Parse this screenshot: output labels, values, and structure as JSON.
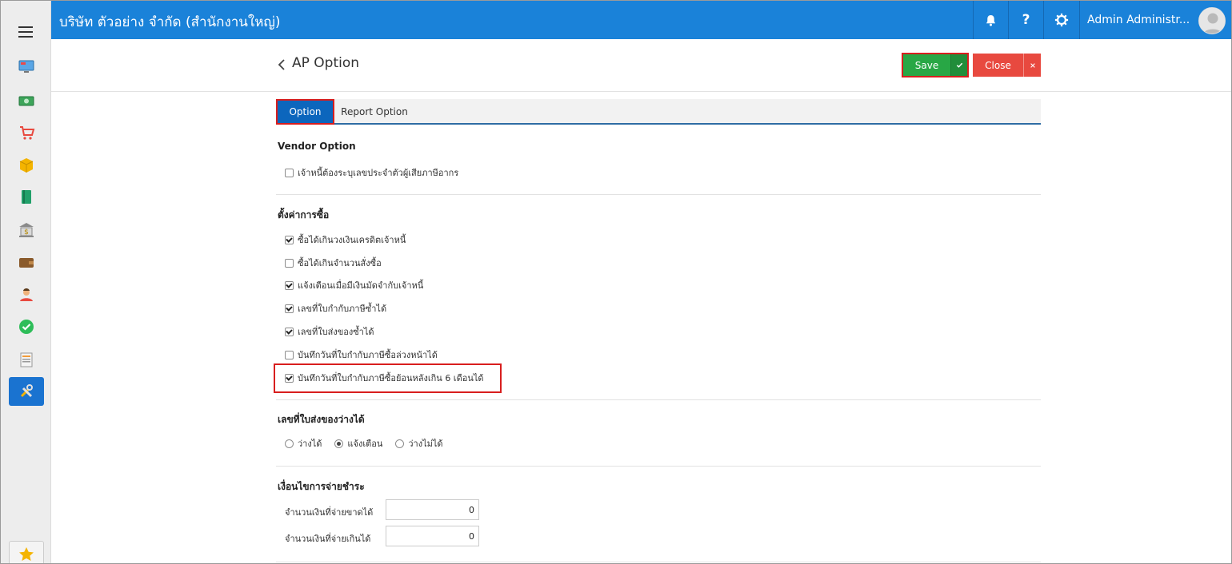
{
  "header": {
    "company": "บริษัท ตัวอย่าง จำกัด (สำนักงานใหญ่)",
    "user_name": "Admin Administr..."
  },
  "page": {
    "title": "AP Option",
    "save_label": "Save",
    "close_label": "Close"
  },
  "tabs": [
    {
      "label": "Option",
      "active": true
    },
    {
      "label": "Report Option",
      "active": false
    }
  ],
  "vendor_option": {
    "heading": "Vendor Option",
    "items": [
      {
        "label": "เจ้าหนี้ต้องระบุเลขประจำตัวผู้เสียภาษีอากร",
        "checked": false
      }
    ]
  },
  "purchase_settings": {
    "heading": "ตั้งค่าการซื้อ",
    "items": [
      {
        "label": "ซื้อได้เกินวงเงินเครดิตเจ้าหนี้",
        "checked": true
      },
      {
        "label": "ซื้อได้เกินจำนวนสั่งซื้อ",
        "checked": false
      },
      {
        "label": "แจ้งเตือนเมื่อมีเงินมัดจำกับเจ้าหนี้",
        "checked": true
      },
      {
        "label": "เลขที่ใบกำกับภาษีซ้ำได้",
        "checked": true
      },
      {
        "label": "เลขที่ใบส่งของซ้ำได้",
        "checked": true
      },
      {
        "label": "บันทึกวันที่ใบกำกับภาษีซื้อล่วงหน้าได้",
        "checked": false
      },
      {
        "label": "บันทึกวันที่ใบกำกับภาษีซื้อย้อนหลังเกิน 6 เดือนได้",
        "checked": true
      }
    ]
  },
  "delivery_blank": {
    "heading": "เลขที่ใบส่งของว่างได้",
    "options": [
      {
        "label": "ว่างได้",
        "checked": false
      },
      {
        "label": "แจ้งเตือน",
        "checked": true
      },
      {
        "label": "ว่างไม่ได้",
        "checked": false
      }
    ]
  },
  "payment_terms": {
    "heading": "เงื่อนไขการจ่ายชำระ",
    "fields": [
      {
        "label": "จำนวนเงินที่จ่ายขาดได้",
        "value": "0"
      },
      {
        "label": "จำนวนเงินที่จ่ายเกินได้",
        "value": "0"
      }
    ]
  },
  "colors": {
    "header_blue": "#1a82d9",
    "save_green": "#28a745",
    "close_red": "#e8493f",
    "highlight_red": "#d81e1e"
  }
}
